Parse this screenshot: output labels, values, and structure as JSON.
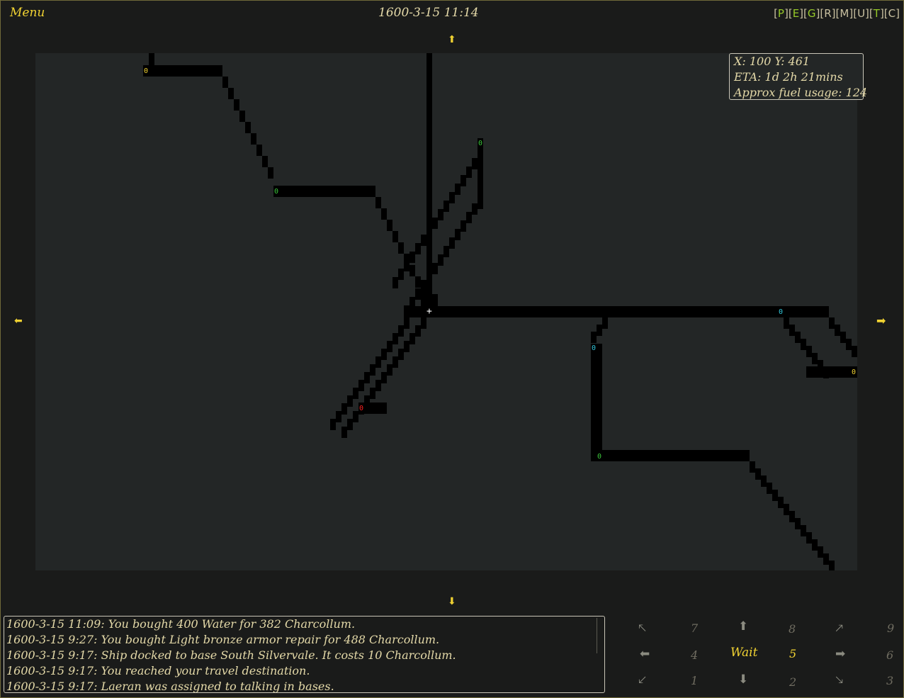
{
  "header": {
    "menu_label": "Menu",
    "date": "1600-3-15 11:14",
    "tabs": [
      "P",
      "E",
      "G",
      "R",
      "M",
      "U",
      "T",
      "C"
    ],
    "tab_colors": {
      "P": "#96c828",
      "E": "#96c828",
      "G": "#96c828",
      "R": "#c8c0a0",
      "M": "#c8c0a0",
      "U": "#c8c0a0",
      "T": "#96c828",
      "C": "#c8c0a0"
    }
  },
  "map": {
    "arrow_up": "⬆",
    "arrow_down": "⬇",
    "arrow_left": "⬅",
    "arrow_right": "➡",
    "cursor_symbol": "+",
    "marker_symbol": "0",
    "marker_colors": {
      "yellow": "#f0d232",
      "green": "#3cc83c",
      "cyan": "#32c8dc",
      "red": "#ff2020"
    }
  },
  "travel_info": {
    "coords": "X: 100 Y: 461",
    "eta": "ETA: 1d 2h 21mins",
    "fuel": "Approx fuel usage: 124"
  },
  "messages": [
    "1600-3-15 11:09: You bought 400 Water for 382 Charcollum.",
    "1600-3-15 9:27: You bought Light bronze armor repair for 488 Charcollum.",
    "1600-3-15 9:17: Ship docked to base South Silvervale. It costs 10 Charcollum.",
    "1600-3-15 9:17: You reached your travel destination.",
    "1600-3-15 9:17: Laeran was assigned to talking in bases."
  ],
  "navigation": {
    "nw": "🡔",
    "n": "⬆",
    "ne": "🡕",
    "w": "⬅",
    "e": "➡",
    "sw": "🡗",
    "s": "⬇",
    "se": "🡖",
    "wait_label": "Wait",
    "keys": [
      "7",
      "8",
      "9",
      "4",
      "5",
      "6",
      "1",
      "2",
      "3"
    ]
  }
}
